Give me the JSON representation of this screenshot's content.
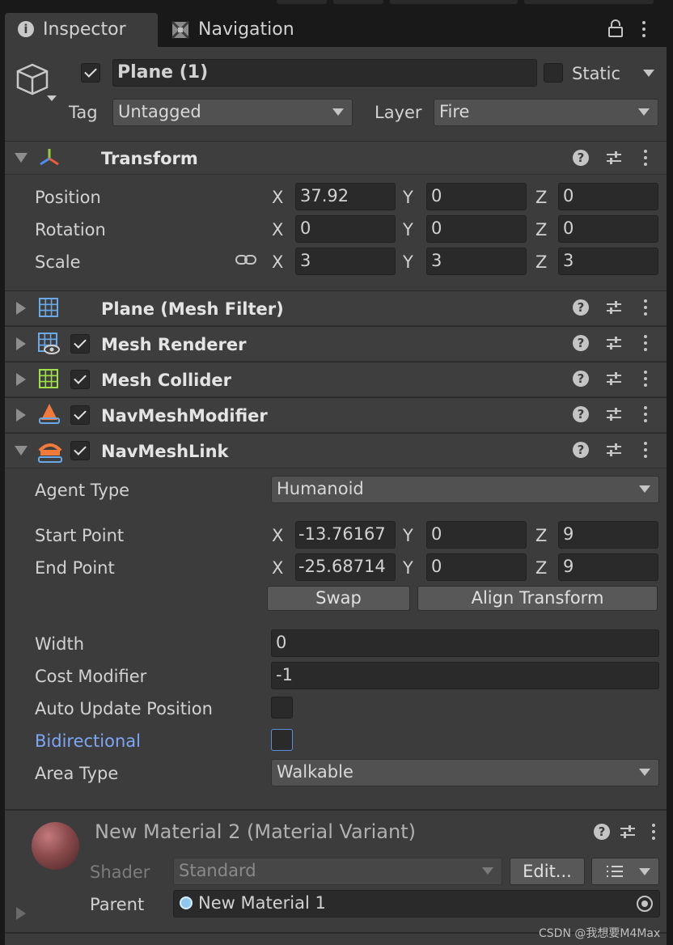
{
  "tabs": {
    "inspector": "Inspector",
    "navigation": "Navigation"
  },
  "object": {
    "name": "Plane (1)",
    "active": true,
    "static_label": "Static",
    "static": false,
    "tag_label": "Tag",
    "tag_value": "Untagged",
    "layer_label": "Layer",
    "layer_value": "Fire"
  },
  "transform": {
    "title": "Transform",
    "position_label": "Position",
    "rotation_label": "Rotation",
    "scale_label": "Scale",
    "axis_x": "X",
    "axis_y": "Y",
    "axis_z": "Z",
    "position": {
      "x": "37.92",
      "y": "0",
      "z": "0"
    },
    "rotation": {
      "x": "0",
      "y": "0",
      "z": "0"
    },
    "scale": {
      "x": "3",
      "y": "3",
      "z": "3"
    }
  },
  "components": [
    {
      "title": "Plane (Mesh Filter)",
      "icon": "mesh-filter-icon",
      "checkbox": false
    },
    {
      "title": "Mesh Renderer",
      "icon": "mesh-renderer-icon",
      "checkbox": true
    },
    {
      "title": "Mesh Collider",
      "icon": "mesh-collider-icon",
      "checkbox": true
    },
    {
      "title": "NavMeshModifier",
      "icon": "navmesh-modifier-icon",
      "checkbox": true
    }
  ],
  "navmesh_link": {
    "title": "NavMeshLink",
    "agent_type_label": "Agent Type",
    "agent_type": "Humanoid",
    "start_label": "Start Point",
    "end_label": "End Point",
    "start": {
      "x": "-13.76167",
      "y": "0",
      "z": "9"
    },
    "end": {
      "x": "-25.68714",
      "y": "0",
      "z": "9"
    },
    "swap": "Swap",
    "align": "Align Transform",
    "width_label": "Width",
    "width": "0",
    "cost_label": "Cost Modifier",
    "cost": "-1",
    "auto_update_label": "Auto Update Position",
    "auto_update": false,
    "bidirectional_label": "Bidirectional",
    "bidirectional": false,
    "area_label": "Area Type",
    "area": "Walkable"
  },
  "material": {
    "title": "New Material 2 (Material Variant)",
    "shader_label": "Shader",
    "shader": "Standard",
    "edit": "Edit...",
    "parent_label": "Parent",
    "parent": "New Material 1"
  },
  "watermark": "CSDN @我想要M4Max",
  "colors": {
    "panel": "#3c3c3c",
    "field": "#2a2a2a",
    "highlight_label": "#7ea6f5",
    "dark": "#191919"
  }
}
